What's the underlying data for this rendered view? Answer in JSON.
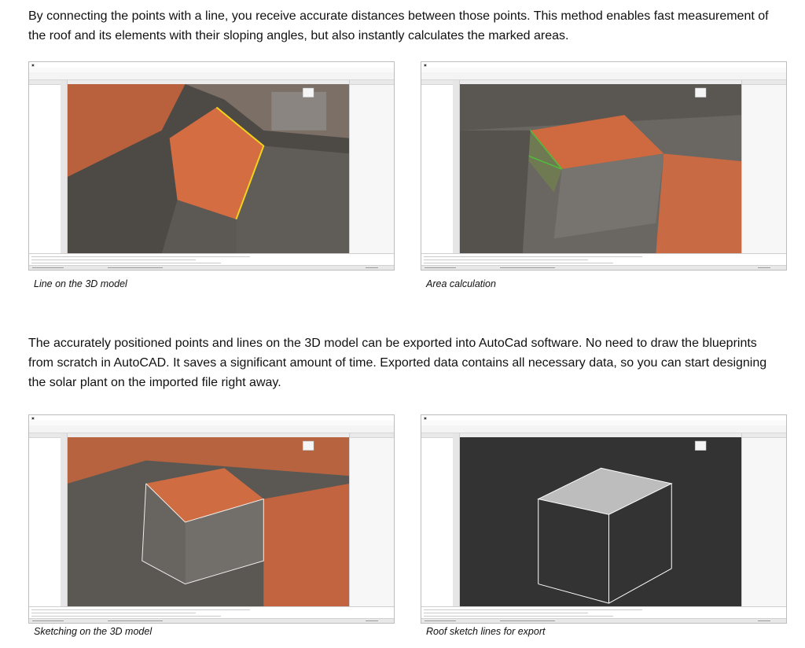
{
  "paragraphs": {
    "p1": "By connecting the points with a line, you receive accurate distances between those points. This method enables fast measurement of the roof and its elements with their sloping angles, but also instantly calculates the marked areas.",
    "p2": "The accurately positioned points and lines on the 3D model can be exported into AutoCad software. No need to draw the blueprints from scratch in AutoCAD. It saves a significant amount of time. Exported data contains all necessary data, so you can start designing the solar plant on the imported file right away."
  },
  "figures": [
    {
      "caption": "Line on the 3D model",
      "highlight": "yellow-line"
    },
    {
      "caption": "Area calculation",
      "highlight": "green-area"
    },
    {
      "caption": "Sketching on the 3D model",
      "highlight": "white-sketch"
    },
    {
      "caption": "Roof sketch lines for export",
      "highlight": "wireframe-export"
    }
  ],
  "colors": {
    "roof": "#c8653c",
    "roof_light": "#e0774a",
    "wall": "#5e5a56",
    "measure_line": "#f2d21b",
    "area_outline": "#4fbf3a",
    "viewport_dark": "#333333",
    "selection": "#3c7fd0"
  }
}
